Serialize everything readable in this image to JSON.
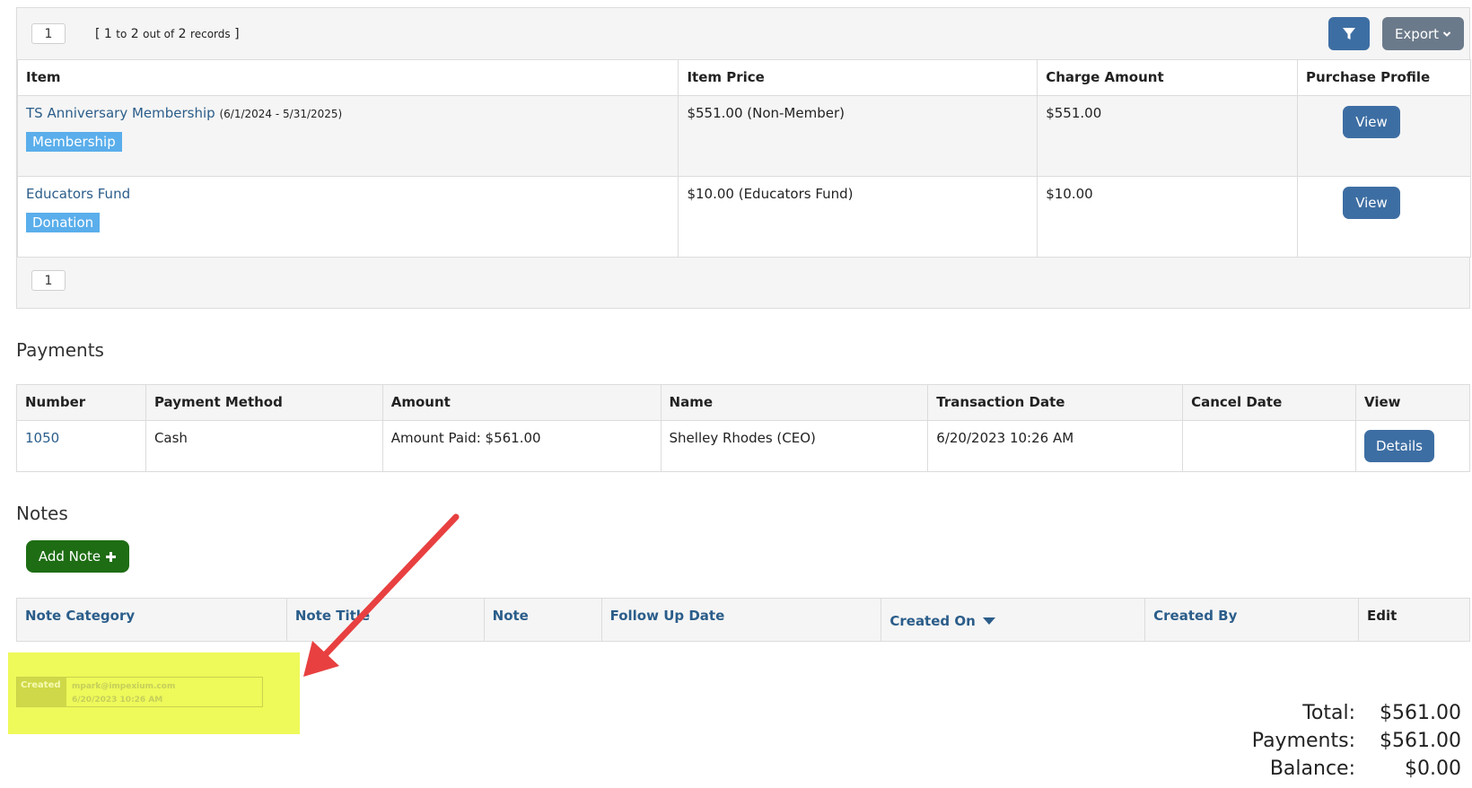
{
  "items_section": {
    "pager_top_page": "1",
    "records": {
      "open": "[",
      "from": "1",
      "to_word": "to",
      "to": "2",
      "of_words": "out of",
      "total": "2",
      "records_word": "records",
      "close": "]"
    },
    "export_label": "Export",
    "pager_bottom_page": "1",
    "columns": [
      "Item",
      "Item Price",
      "Charge Amount",
      "Purchase Profile"
    ],
    "rows": [
      {
        "item": "TS Anniversary Membership",
        "period": "(6/1/2024 - 5/31/2025)",
        "tag": "Membership",
        "price": "$551.00 (Non-Member)",
        "charge": "$551.00",
        "action": "View"
      },
      {
        "item": "Educators Fund",
        "period": "",
        "tag": "Donation",
        "price": "$10.00 (Educators Fund)",
        "charge": "$10.00",
        "action": "View"
      }
    ]
  },
  "payments": {
    "heading": "Payments",
    "columns": [
      "Number",
      "Payment Method",
      "Amount",
      "Name",
      "Transaction Date",
      "Cancel Date",
      "View"
    ],
    "rows": [
      {
        "number": "1050",
        "method": "Cash",
        "amount": "Amount Paid: $561.00",
        "name": "Shelley Rhodes (CEO)",
        "transaction_date": "6/20/2023 10:26 AM",
        "cancel_date": "",
        "action": "Details"
      }
    ]
  },
  "notes": {
    "heading": "Notes",
    "add_label": "Add Note",
    "columns": [
      "Note Category",
      "Note Title",
      "Note",
      "Follow Up Date",
      "Created On",
      "Created By",
      "Edit"
    ]
  },
  "annotation": {
    "label": "Created",
    "email": "mpark@impexium.com",
    "datetime": "6/20/2023 10:26 AM",
    "highlight_color": "#eef95a",
    "arrow_color": "#e84040"
  },
  "totals": {
    "total_label": "Total:",
    "total_value": "$561.00",
    "payments_label": "Payments:",
    "payments_value": "$561.00",
    "balance_label": "Balance:",
    "balance_value": "$0.00"
  },
  "colors": {
    "primary": "#3d6ea3",
    "success": "#1e6d14",
    "tag": "#5aaeeb",
    "link": "#2b5d8a"
  }
}
